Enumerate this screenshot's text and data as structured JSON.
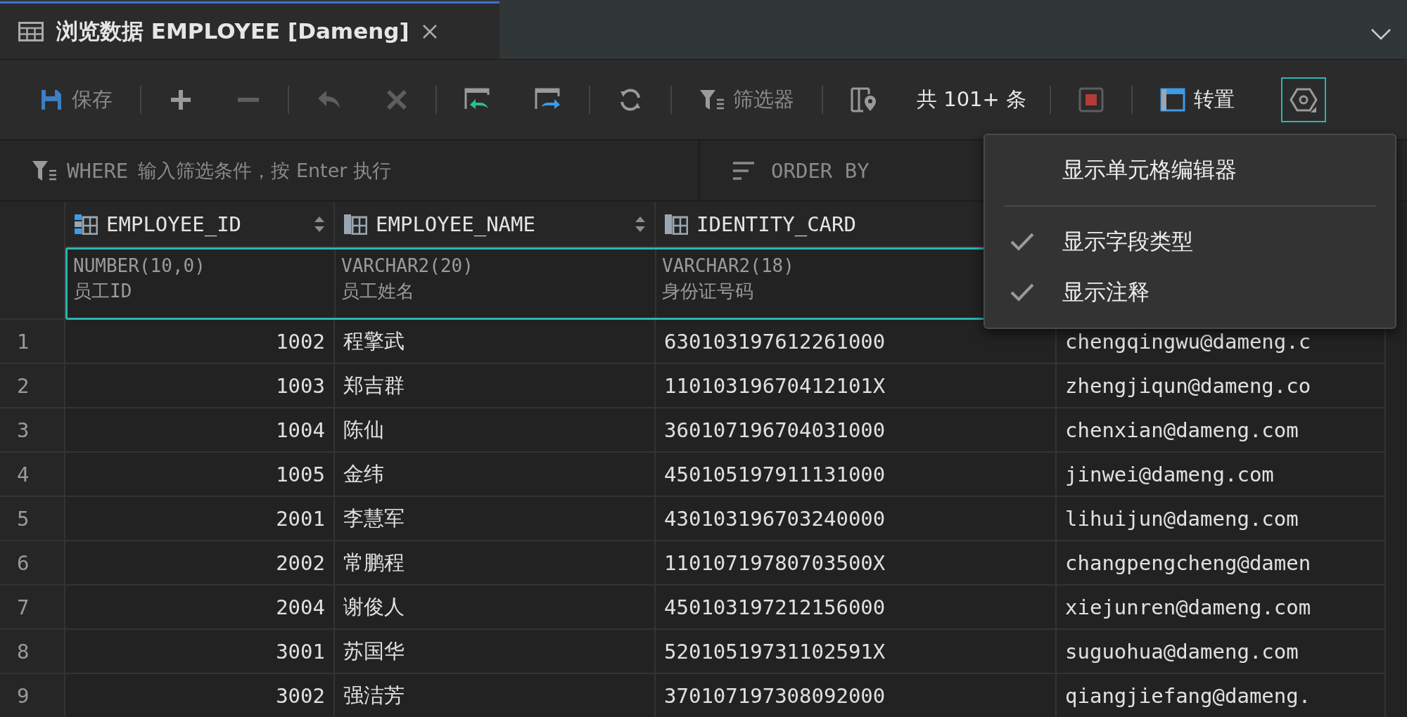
{
  "tab": {
    "title": "浏览数据 EMPLOYEE [Dameng]",
    "selected": true
  },
  "toolbar": {
    "groups": [
      {
        "items": [
          {
            "kind": "save",
            "label": "保存"
          }
        ]
      },
      {
        "items": [
          {
            "kind": "add"
          },
          {
            "kind": "remove"
          }
        ]
      },
      {
        "items": [
          {
            "kind": "undo"
          },
          {
            "kind": "delete"
          }
        ]
      },
      {
        "items": [
          {
            "kind": "import"
          },
          {
            "kind": "export"
          }
        ]
      },
      {
        "items": [
          {
            "kind": "refresh"
          }
        ]
      },
      {
        "items": [
          {
            "kind": "filter",
            "label": "筛选器"
          }
        ]
      },
      {
        "items": [
          {
            "kind": "map"
          },
          {
            "kind": "count",
            "label": "共 101+ 条"
          }
        ]
      },
      {
        "items": [
          {
            "kind": "stop"
          }
        ]
      },
      {
        "items": [
          {
            "kind": "transpose",
            "label": "转置"
          },
          {
            "kind": "settings",
            "selected": true
          }
        ]
      }
    ]
  },
  "filter_bar": {
    "where": {
      "keyword": "WHERE",
      "placeholder": "输入筛选条件，按 Enter 执行"
    },
    "order_by": {
      "keyword": "ORDER BY"
    }
  },
  "columns": [
    {
      "name": "EMPLOYEE_ID",
      "type": "NUMBER(10,0)",
      "comment": "员工ID",
      "key": true,
      "sortable": true
    },
    {
      "name": "EMPLOYEE_NAME",
      "type": "VARCHAR2(20)",
      "comment": "员工姓名",
      "key": false,
      "sortable": true
    },
    {
      "name": "IDENTITY_CARD",
      "type": "VARCHAR2(18)",
      "comment": "身份证号码",
      "key": false
    }
  ],
  "rows": [
    {
      "number": "1",
      "cells": [
        "1002",
        "程擎武",
        "630103197612261000",
        "chengqingwu@dameng.c"
      ]
    },
    {
      "number": "2",
      "cells": [
        "1003",
        "郑吉群",
        "11010319670412101X",
        "zhengjiqun@dameng.co"
      ]
    },
    {
      "number": "3",
      "cells": [
        "1004",
        "陈仙",
        "360107196704031000",
        "chenxian@dameng.com"
      ]
    },
    {
      "number": "4",
      "cells": [
        "1005",
        "金纬",
        "450105197911131000",
        "jinwei@dameng.com"
      ]
    },
    {
      "number": "5",
      "cells": [
        "2001",
        "李慧军",
        "430103196703240000",
        "lihuijun@dameng.com"
      ]
    },
    {
      "number": "6",
      "cells": [
        "2002",
        "常鹏程",
        "11010719780703500X",
        "changpengcheng@damen"
      ]
    },
    {
      "number": "7",
      "cells": [
        "2004",
        "谢俊人",
        "450103197212156000",
        "xiejunren@dameng.com"
      ]
    },
    {
      "number": "8",
      "cells": [
        "3001",
        "苏国华",
        "52010519731102591X",
        "suguohua@dameng.com"
      ]
    },
    {
      "number": "9",
      "cells": [
        "3002",
        "强洁芳",
        "370107197308092000",
        "qiangjiefang@dameng."
      ]
    }
  ],
  "menu": {
    "sections": [
      {
        "items": [
          {
            "label": "显示单元格编辑器",
            "checked": false
          }
        ]
      },
      {
        "items": [
          {
            "label": "显示字段类型",
            "checked": true
          },
          {
            "label": "显示注释",
            "checked": true
          }
        ]
      }
    ]
  }
}
